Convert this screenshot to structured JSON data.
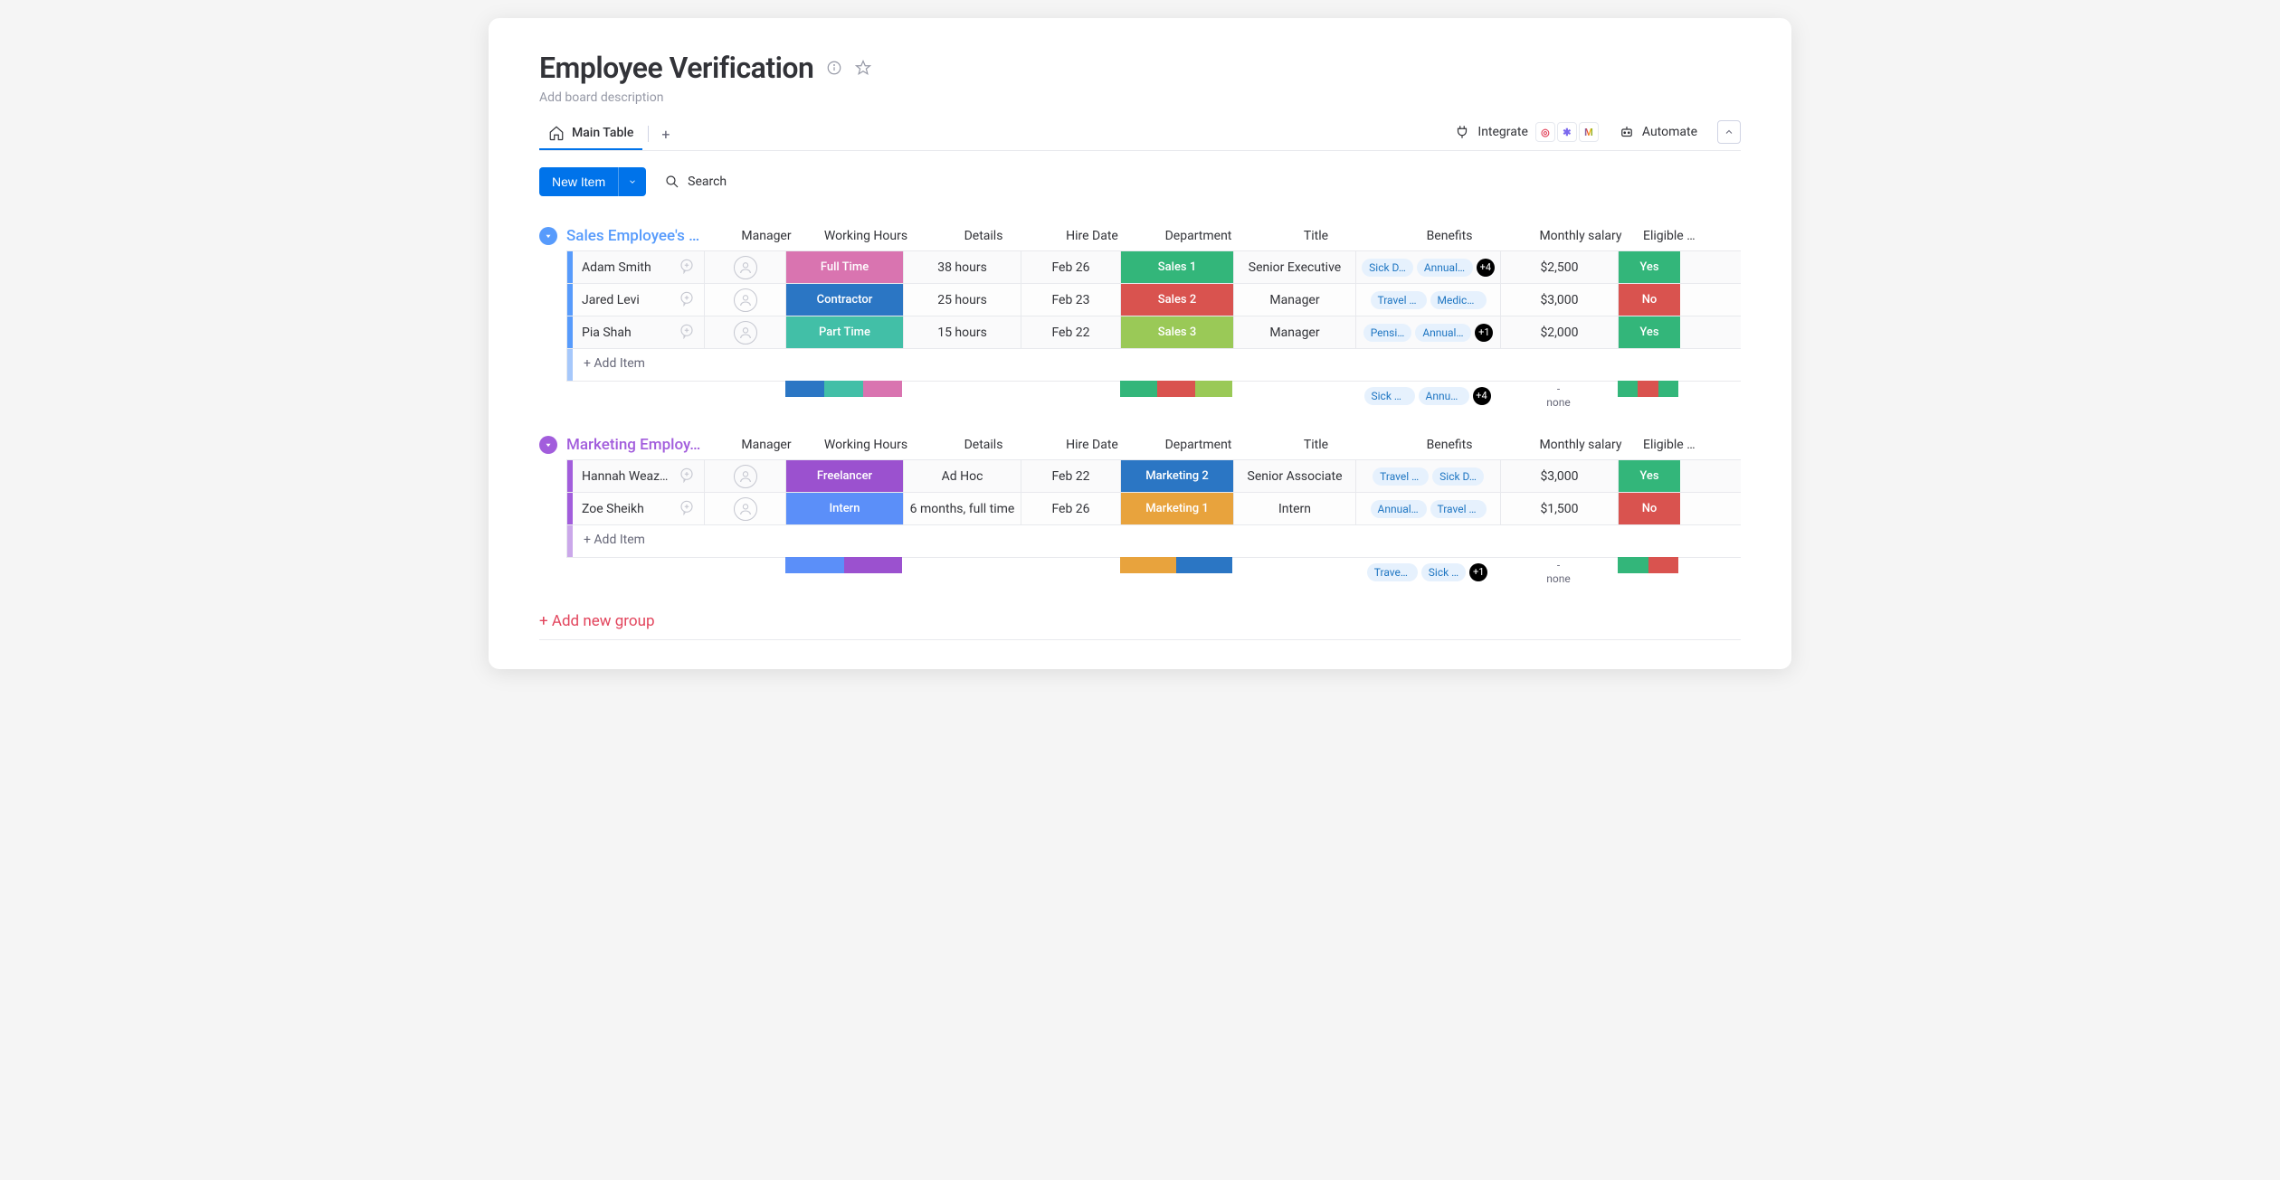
{
  "page_title": "Employee Verification",
  "description_placeholder": "Add board description",
  "tabs": {
    "main": "Main Table"
  },
  "top_actions": {
    "integrate": "Integrate",
    "automate": "Automate"
  },
  "toolbar": {
    "new_item": "New Item",
    "search": "Search"
  },
  "columns": {
    "manager": "Manager",
    "working_hours": "Working Hours",
    "details": "Details",
    "hire_date": "Hire Date",
    "department": "Department",
    "title": "Title",
    "benefits": "Benefits",
    "monthly_salary": "Monthly salary",
    "eligible": "Eligible f…"
  },
  "groups": [
    {
      "id": "sales",
      "title": "Sales Employee's …",
      "color": "#579bfc",
      "toggle_color": "#579bfc",
      "color_light": "#a6c8fb",
      "rows": [
        {
          "name": "Adam Smith",
          "working_hours": {
            "label": "Full Time",
            "color": "#d974b0"
          },
          "details": "38 hours",
          "hire_date": "Feb 26",
          "department": {
            "label": "Sales 1",
            "color": "#33b67a"
          },
          "title": "Senior Executive",
          "benefits": {
            "chips": [
              "Sick D…",
              "Annual L…"
            ],
            "more": "+4"
          },
          "salary": "$2,500",
          "eligible": {
            "label": "Yes",
            "color": "#33b67a"
          }
        },
        {
          "name": "Jared Levi",
          "working_hours": {
            "label": "Contractor",
            "color": "#2b76c4"
          },
          "details": "25 hours",
          "hire_date": "Feb 23",
          "department": {
            "label": "Sales 2",
            "color": "#d9534f"
          },
          "title": "Manager",
          "benefits": {
            "chips": [
              "Travel All…",
              "Medical …"
            ],
            "more": ""
          },
          "salary": "$3,000",
          "eligible": {
            "label": "No",
            "color": "#d9534f"
          }
        },
        {
          "name": "Pia Shah",
          "working_hours": {
            "label": "Part Time",
            "color": "#42bfa7"
          },
          "details": "15 hours",
          "hire_date": "Feb 22",
          "department": {
            "label": "Sales 3",
            "color": "#9ac957"
          },
          "title": "Manager",
          "benefits": {
            "chips": [
              "Pensi…",
              "Annual Le…"
            ],
            "more": "+1"
          },
          "salary": "$2,000",
          "eligible": {
            "label": "Yes",
            "color": "#33b67a"
          }
        }
      ],
      "add_item": "+ Add Item",
      "summary": {
        "working_hours_colors": [
          "#2b76c4",
          "#42bfa7",
          "#d974b0"
        ],
        "department_colors": [
          "#33b67a",
          "#d9534f",
          "#9ac957"
        ],
        "benefits": {
          "chips": [
            "Sick D…",
            "Annual L…"
          ],
          "more": "+4"
        },
        "salary": {
          "top": "-",
          "bottom": "none"
        },
        "eligible_colors": [
          "#33b67a",
          "#d9534f",
          "#33b67a"
        ]
      }
    },
    {
      "id": "marketing",
      "title": "Marketing Employ…",
      "color": "#a25ddc",
      "toggle_color": "#a25ddc",
      "color_light": "#cba8ea",
      "rows": [
        {
          "name": "Hannah Weaz…",
          "working_hours": {
            "label": "Freelancer",
            "color": "#9b51cf"
          },
          "details": "Ad Hoc",
          "hire_date": "Feb 22",
          "department": {
            "label": "Marketing 2",
            "color": "#2b76c4"
          },
          "title": "Senior Associate",
          "benefits": {
            "chips": [
              "Travel Allow…",
              "Sick D…"
            ],
            "more": ""
          },
          "salary": "$3,000",
          "eligible": {
            "label": "Yes",
            "color": "#33b67a"
          }
        },
        {
          "name": "Zoe Sheikh",
          "working_hours": {
            "label": "Intern",
            "color": "#5b8ff9"
          },
          "details": "6 months, full time",
          "hire_date": "Feb 26",
          "department": {
            "label": "Marketing 1",
            "color": "#e8a33d"
          },
          "title": "Intern",
          "benefits": {
            "chips": [
              "Annual …",
              "Travel Allo…"
            ],
            "more": ""
          },
          "salary": "$1,500",
          "eligible": {
            "label": "No",
            "color": "#d9534f"
          }
        }
      ],
      "add_item": "+ Add Item",
      "summary": {
        "working_hours_colors": [
          "#5b8ff9",
          "#9b51cf"
        ],
        "department_colors": [
          "#e8a33d",
          "#2b76c4"
        ],
        "benefits": {
          "chips": [
            "Travel Allo…",
            "Sick …"
          ],
          "more": "+1"
        },
        "salary": {
          "top": "-",
          "bottom": "none"
        },
        "eligible_colors": [
          "#33b67a",
          "#d9534f"
        ]
      }
    }
  ],
  "add_group": "+ Add new group"
}
